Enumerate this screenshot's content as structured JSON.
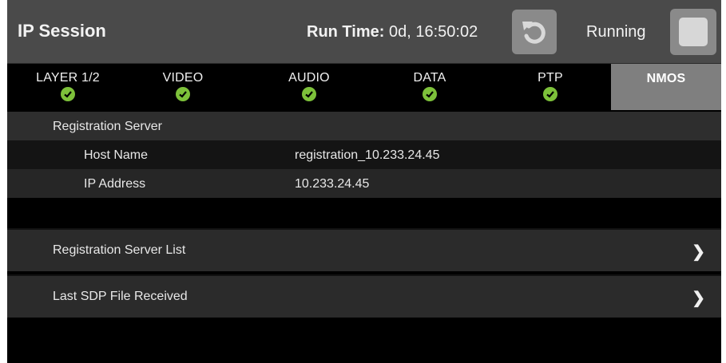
{
  "header": {
    "title": "IP Session",
    "runtime_label": "Run Time:",
    "runtime_value": "0d, 16:50:02",
    "status": "Running"
  },
  "tabs": [
    {
      "label": "LAYER 1/2",
      "status": "ok",
      "active": false
    },
    {
      "label": "VIDEO",
      "status": "ok",
      "active": false
    },
    {
      "label": "AUDIO",
      "status": "ok",
      "active": false
    },
    {
      "label": "DATA",
      "status": "ok",
      "active": false
    },
    {
      "label": "PTP",
      "status": "ok",
      "active": false
    },
    {
      "label": "NMOS",
      "active": true
    }
  ],
  "registration_server": {
    "heading": "Registration Server",
    "host_name_label": "Host Name",
    "host_name_value": "registration_10.233.24.45",
    "ip_address_label": "IP Address",
    "ip_address_value": "10.233.24.45"
  },
  "nav": {
    "registration_server_list": "Registration Server List",
    "last_sdp_file": "Last SDP File Received"
  },
  "icons": {
    "restart": "restart-icon",
    "stop": "stop-icon",
    "status_ok": "check-circle-icon",
    "chevron": "chevron-right-icon"
  },
  "colors": {
    "ok_green": "#7dc13a",
    "header_bg": "#4a4a4a",
    "active_tab_bg": "#7f7f7f"
  }
}
